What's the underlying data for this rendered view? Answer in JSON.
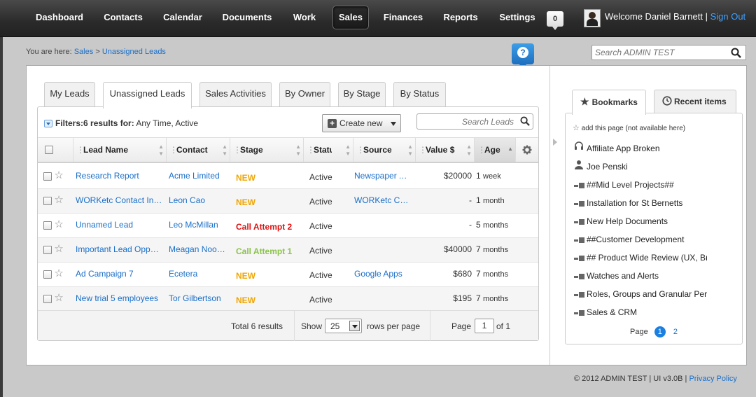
{
  "nav": {
    "items": [
      {
        "label": "Dashboard"
      },
      {
        "label": "Contacts"
      },
      {
        "label": "Calendar"
      },
      {
        "label": "Documents"
      },
      {
        "label": "Work"
      },
      {
        "label": "Sales"
      },
      {
        "label": "Finances"
      },
      {
        "label": "Reports"
      },
      {
        "label": "Settings"
      }
    ],
    "active": "Sales",
    "notification_count": "0",
    "welcome": "Welcome Daniel Barnett",
    "separator": "|",
    "sign_out": "Sign Out"
  },
  "breadcrumb": {
    "prefix": "You are here:",
    "section": "Sales",
    "sep": ">",
    "current": "Unassigned Leads"
  },
  "help_icon": "?",
  "top_search": {
    "placeholder": "Search ADMIN TEST"
  },
  "tabs": [
    {
      "label": "My Leads"
    },
    {
      "label": "Unassigned Leads"
    },
    {
      "label": "Sales Activities"
    },
    {
      "label": "By Owner"
    },
    {
      "label": "By Stage"
    },
    {
      "label": "By Status"
    }
  ],
  "active_tab": "Unassigned Leads",
  "filters": {
    "label": "Filters:",
    "count_text": "6 results for:",
    "criteria": "Any Time, Active"
  },
  "create_new": {
    "label": "Create new",
    "icon": "+"
  },
  "leads_search": {
    "placeholder": "Search Leads"
  },
  "table": {
    "columns": [
      "Lead Name",
      "Contact",
      "Stage",
      "Status",
      "Source",
      "Value $",
      "Age"
    ],
    "sorted_by": "Age",
    "rows": [
      {
        "name": "Research Report",
        "contact": "Acme Limited",
        "stage": "NEW",
        "stage_kind": "new",
        "status": "Active",
        "source": "Newspaper Advertisement",
        "value": "$20000",
        "age_num": "1",
        "age_unit": "week"
      },
      {
        "name": "WORKetc Contact Information",
        "contact": "Leon Cao",
        "stage": "NEW",
        "stage_kind": "new",
        "status": "Active",
        "source": "WORKetc Contact Form",
        "value": "-",
        "age_num": "1",
        "age_unit": "month"
      },
      {
        "name": "Unnamed Lead",
        "contact": "Leo McMillan",
        "stage": "Call Attempt 2",
        "stage_kind": "call",
        "status": "Active",
        "source": "",
        "value": "-",
        "age_num": "5",
        "age_unit": "months"
      },
      {
        "name": "Important Lead Opportunity",
        "contact": "Meagan Noonan",
        "stage": "Call Attempt 1",
        "stage_kind": "call1",
        "status": "Active",
        "source": "",
        "value": "$40000",
        "age_num": "7",
        "age_unit": "months"
      },
      {
        "name": "Ad Campaign 7",
        "contact": "Ecetera",
        "stage": "NEW",
        "stage_kind": "new",
        "status": "Active",
        "source": "Google Apps",
        "value": "$680",
        "age_num": "7",
        "age_unit": "months"
      },
      {
        "name": "New trial 5 employees",
        "contact": "Tor Gilbertson",
        "stage": "NEW",
        "stage_kind": "new",
        "status": "Active",
        "source": "",
        "value": "$195",
        "age_num": "7",
        "age_unit": "months"
      }
    ]
  },
  "footer_bar": {
    "total": "Total 6 results",
    "show_label": "Show",
    "rows_per_page": "25",
    "rows_label": "rows per page",
    "page_label": "Page",
    "page_current": "1",
    "page_of": "of 1"
  },
  "side_tabs": [
    {
      "label": "Bookmarks"
    },
    {
      "label": "Recent items"
    }
  ],
  "bookmarks": {
    "add_text": "add this page (not available here)",
    "items": [
      {
        "label": "Affiliate App Broken",
        "icon": "headset-icon"
      },
      {
        "label": "Joe Penski",
        "icon": "person-icon"
      },
      {
        "label": "##Mid Level Projects##",
        "icon": "project-icon"
      },
      {
        "label": "Installation for St Bernetts",
        "icon": "project-icon"
      },
      {
        "label": "New Help Documents",
        "icon": "project-icon"
      },
      {
        "label": "##Customer Development",
        "icon": "project-icon"
      },
      {
        "label": "## Product Wide Review (UX, Branding)",
        "icon": "project-icon"
      },
      {
        "label": "Watches and Alerts",
        "icon": "project-icon"
      },
      {
        "label": "Roles, Groups and Granular Permissions",
        "icon": "project-icon"
      },
      {
        "label": "Sales & CRM",
        "icon": "project-icon"
      }
    ],
    "page_label": "Page",
    "page_current": "1",
    "page_next": "2"
  },
  "footer": {
    "text": "© 2012 ADMIN TEST | UI v3.0B |",
    "link": "Privacy Policy"
  }
}
